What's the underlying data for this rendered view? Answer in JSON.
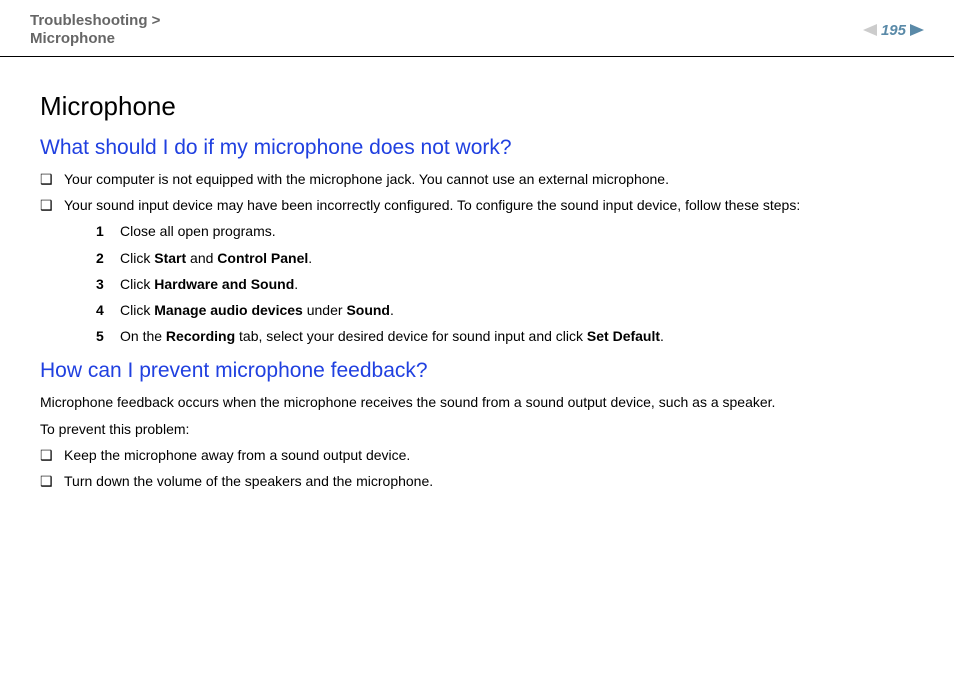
{
  "header": {
    "breadcrumb_line1": "Troubleshooting >",
    "breadcrumb_line2": "Microphone",
    "page_number": "195"
  },
  "title": "Microphone",
  "section1": {
    "heading": "What should I do if my microphone does not work?",
    "bullets": [
      "Your computer is not equipped with the microphone jack. You cannot use an external microphone.",
      "Your sound input device may have been incorrectly configured. To configure the sound input device, follow these steps:"
    ],
    "steps": [
      {
        "n": "1",
        "pre": "Close all open programs."
      },
      {
        "n": "2",
        "pre": "Click ",
        "b1": "Start",
        "mid": " and ",
        "b2": "Control Panel",
        "post": "."
      },
      {
        "n": "3",
        "pre": "Click ",
        "b1": "Hardware and Sound",
        "post": "."
      },
      {
        "n": "4",
        "pre": "Click ",
        "b1": "Manage audio devices",
        "mid": " under ",
        "b2": "Sound",
        "post": "."
      },
      {
        "n": "5",
        "pre": "On the ",
        "b1": "Recording",
        "mid": " tab, select your desired device for sound input and click ",
        "b2": "Set Default",
        "post": "."
      }
    ]
  },
  "section2": {
    "heading": "How can I prevent microphone feedback?",
    "para1": "Microphone feedback occurs when the microphone receives the sound from a sound output device, such as a speaker.",
    "para2": "To prevent this problem:",
    "bullets": [
      "Keep the microphone away from a sound output device.",
      "Turn down the volume of the speakers and the microphone."
    ]
  }
}
